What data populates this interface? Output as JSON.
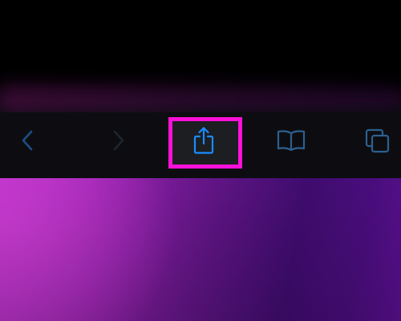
{
  "toolbar": {
    "buttons": [
      {
        "id": "back",
        "icon": "chevron-left-icon",
        "enabled": true
      },
      {
        "id": "forward",
        "icon": "chevron-right-icon",
        "enabled": false
      },
      {
        "id": "share",
        "icon": "share-icon",
        "enabled": true,
        "highlighted": true
      },
      {
        "id": "bookmarks",
        "icon": "book-icon",
        "enabled": true
      },
      {
        "id": "tabs",
        "icon": "tabs-icon",
        "enabled": true
      }
    ]
  },
  "colors": {
    "icon_active": "#1a8cff",
    "icon_disabled": "#2a3038",
    "icon_dim": "#2d5f8f",
    "highlight": "#ff10d8",
    "toolbar_bg": "#0d0d11",
    "wallpaper_left": "#c83ad0",
    "wallpaper_right": "#4a0d7d"
  }
}
